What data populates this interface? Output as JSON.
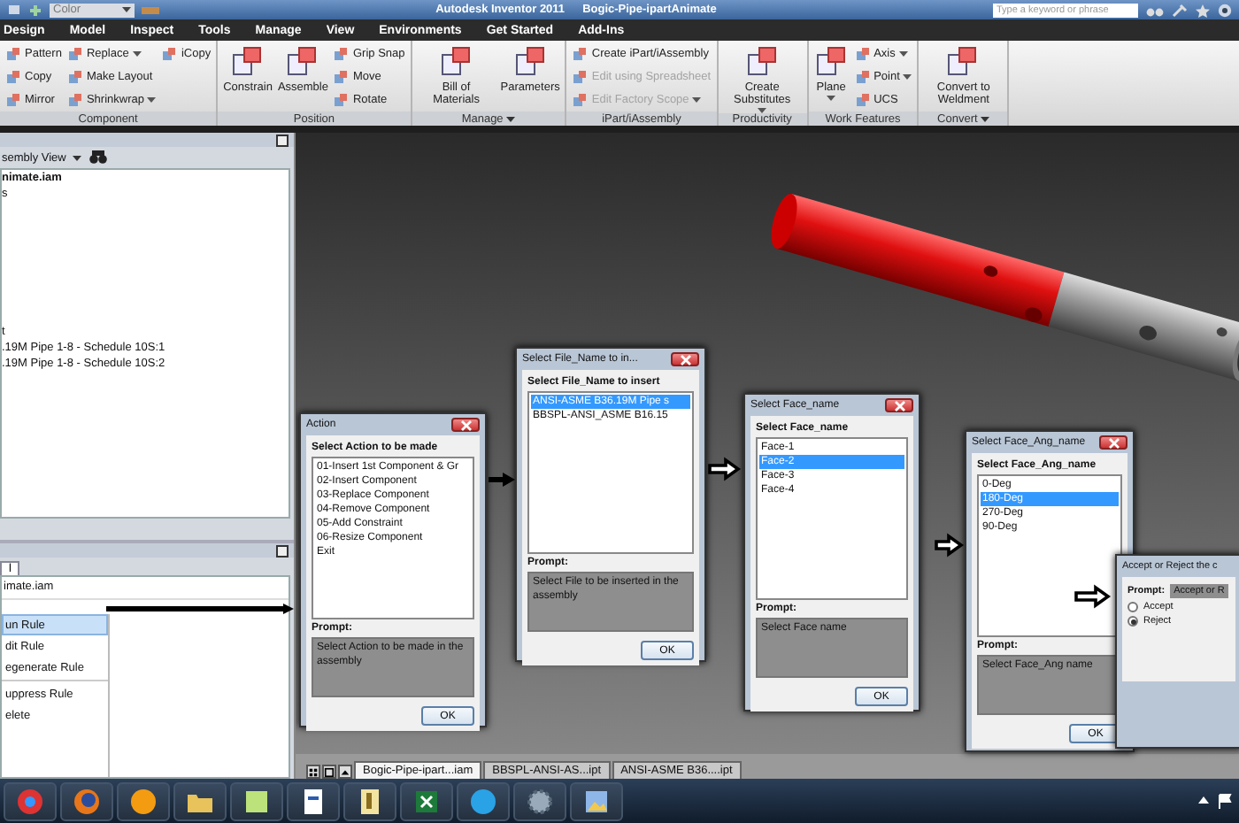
{
  "title_bar": {
    "style_field": "Color",
    "title": "Autodesk Inventor 2011",
    "document": "Bogic-Pipe-ipartAnimate",
    "search": {
      "placeholder": "Type a keyword or phrase"
    }
  },
  "ribbon_tabs": [
    "Design",
    "Model",
    "Inspect",
    "Tools",
    "Manage",
    "View",
    "Environments",
    "Get Started",
    "Add-Ins"
  ],
  "ribbon_groups": [
    {
      "label": "Component",
      "dropdown": false,
      "tools": [
        {
          "label": "Pattern",
          "kind": "small",
          "dropdown": false,
          "disabled": false
        },
        {
          "label": "Copy",
          "kind": "small",
          "dropdown": false,
          "disabled": false
        },
        {
          "label": "Mirror",
          "kind": "small",
          "dropdown": false,
          "disabled": false
        },
        {
          "label": "Replace",
          "kind": "small",
          "dropdown": true,
          "disabled": false
        },
        {
          "label": "Make Layout",
          "kind": "small",
          "dropdown": false,
          "disabled": false
        },
        {
          "label": "Shrinkwrap",
          "kind": "small",
          "dropdown": true,
          "disabled": false
        },
        {
          "label": "iCopy",
          "kind": "small",
          "dropdown": false,
          "disabled": false
        }
      ]
    },
    {
      "label": "Position",
      "dropdown": false,
      "tools": [
        {
          "label": "Constrain",
          "kind": "large",
          "dropdown": false,
          "disabled": false
        },
        {
          "label": "Assemble",
          "kind": "large",
          "dropdown": false,
          "disabled": false
        },
        {
          "label": "Grip Snap",
          "kind": "small",
          "dropdown": false,
          "disabled": false
        },
        {
          "label": "Move",
          "kind": "small",
          "dropdown": false,
          "disabled": false
        },
        {
          "label": "Rotate",
          "kind": "small",
          "dropdown": false,
          "disabled": false
        }
      ]
    },
    {
      "label": "Manage",
      "dropdown": true,
      "tools": [
        {
          "label": "Bill of Materials",
          "kind": "large",
          "dropdown": false,
          "disabled": false
        },
        {
          "label": "Parameters",
          "kind": "large",
          "dropdown": false,
          "disabled": false
        }
      ]
    },
    {
      "label": "iPart/iAssembly",
      "dropdown": false,
      "tools": [
        {
          "label": "Create iPart/iAssembly",
          "kind": "small",
          "dropdown": false,
          "disabled": false
        },
        {
          "label": "Edit using Spreadsheet",
          "kind": "small",
          "dropdown": false,
          "disabled": true
        },
        {
          "label": "Edit Factory Scope",
          "kind": "small",
          "dropdown": true,
          "disabled": true
        }
      ]
    },
    {
      "label": "Productivity",
      "dropdown": false,
      "tools": [
        {
          "label": "Create Substitutes",
          "kind": "large",
          "dropdown": true,
          "disabled": false
        }
      ]
    },
    {
      "label": "Work Features",
      "dropdown": false,
      "tools": [
        {
          "label": "Plane",
          "kind": "large",
          "dropdown": true,
          "disabled": false
        },
        {
          "label": "Axis",
          "kind": "small",
          "dropdown": true,
          "disabled": false
        },
        {
          "label": "Point",
          "kind": "small",
          "dropdown": true,
          "disabled": false
        },
        {
          "label": "UCS",
          "kind": "small",
          "dropdown": false,
          "disabled": false
        }
      ]
    },
    {
      "label": "Convert",
      "dropdown": true,
      "tools": [
        {
          "label": "Convert to Weldment",
          "kind": "large",
          "dropdown": false,
          "disabled": false
        }
      ]
    }
  ],
  "model_browser": {
    "view_selector": "sembly View",
    "root": "nimate.iam",
    "items": [
      "s",
      "t",
      ".19M Pipe 1-8 - Schedule 10S:1",
      ".19M Pipe 1-8 - Schedule 10S:2"
    ]
  },
  "ilogic_browser": {
    "tab": "l",
    "root": "imate.iam",
    "menu": [
      {
        "label": "un Rule",
        "selected": true
      },
      {
        "label": "dit Rule",
        "selected": false
      },
      {
        "label": "egenerate Rule",
        "selected": false
      },
      {
        "label": "uppress Rule",
        "selected": false
      },
      {
        "label": "elete",
        "selected": false
      }
    ]
  },
  "dialogs": [
    {
      "kind": "list",
      "title": "Action",
      "list_label": "Select Action to be made",
      "items": [
        {
          "label": "01-Insert 1st Component & Gr",
          "selected": false
        },
        {
          "label": "02-Insert Component",
          "selected": false
        },
        {
          "label": "03-Replace Component",
          "selected": false
        },
        {
          "label": "04-Remove Component",
          "selected": false
        },
        {
          "label": "05-Add Constraint",
          "selected": false
        },
        {
          "label": "06-Resize Component",
          "selected": false
        },
        {
          "label": "Exit",
          "selected": false
        }
      ],
      "prompt_label": "Prompt:",
      "prompt": "Select Action to be made in the assembly",
      "button": "OK"
    },
    {
      "kind": "list",
      "title": "Select File_Name to in...",
      "list_label": "Select File_Name to insert",
      "items": [
        {
          "label": "ANSI-ASME B36.19M Pipe s",
          "selected": true
        },
        {
          "label": "BBSPL-ANSI_ASME B16.15",
          "selected": false
        }
      ],
      "prompt_label": "Prompt:",
      "prompt": "Select File to be inserted in the assembly",
      "button": "OK"
    },
    {
      "kind": "list",
      "title": "Select Face_name",
      "list_label": "Select Face_name",
      "items": [
        {
          "label": "Face-1",
          "selected": false
        },
        {
          "label": "Face-2",
          "selected": true
        },
        {
          "label": "Face-3",
          "selected": false
        },
        {
          "label": "Face-4",
          "selected": false
        }
      ],
      "prompt_label": "Prompt:",
      "prompt": "Select Face name",
      "button": "OK"
    },
    {
      "kind": "list",
      "title": "Select Face_Ang_name",
      "list_label": "Select Face_Ang_name",
      "items": [
        {
          "label": "0-Deg",
          "selected": false
        },
        {
          "label": "180-Deg",
          "selected": true
        },
        {
          "label": "270-Deg",
          "selected": false
        },
        {
          "label": "90-Deg",
          "selected": false
        }
      ],
      "prompt_label": "Prompt:",
      "prompt": "Select Face_Ang name",
      "button": "OK"
    },
    {
      "kind": "choice",
      "title": "Accept or Reject the c",
      "prompt_label": "Prompt:",
      "prompt": "Accept or R",
      "options": [
        {
          "label": "Accept",
          "selected": false
        },
        {
          "label": "Reject",
          "selected": true
        }
      ]
    }
  ],
  "document_tabs": [
    {
      "label": "Bogic-Pipe-ipart...iam",
      "selected": true
    },
    {
      "label": "BBSPL-ANSI-AS...ipt",
      "selected": false
    },
    {
      "label": "ANSI-ASME B36....ipt",
      "selected": false
    }
  ]
}
